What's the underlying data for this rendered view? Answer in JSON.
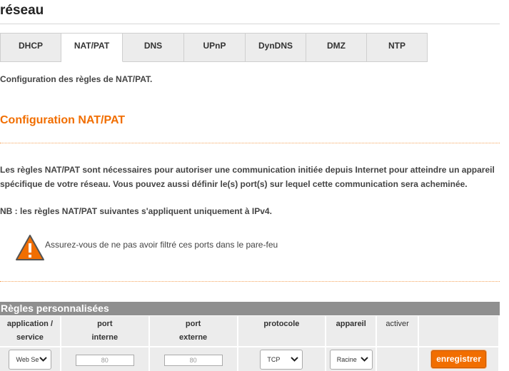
{
  "page": {
    "title": "réseau"
  },
  "tabs": [
    {
      "label": "DHCP"
    },
    {
      "label": "NAT/PAT"
    },
    {
      "label": "DNS"
    },
    {
      "label": "UPnP"
    },
    {
      "label": "DynDNS"
    },
    {
      "label": "DMZ"
    },
    {
      "label": "NTP"
    }
  ],
  "active_tab": "NAT/PAT",
  "intro": "Configuration des règles de NAT/PAT.",
  "section": {
    "title": "Configuration NAT/PAT",
    "paragraph": "Les règles NAT/PAT sont nécessaires pour autoriser une communication initiée depuis Internet pour atteindre un appareil spécifique de votre réseau. Vous pouvez aussi définir le(s) port(s) sur lequel cette communication sera acheminée.",
    "note": "NB : les règles NAT/PAT suivantes s'appliquent uniquement à IPv4.",
    "warning": "Assurez-vous de ne pas avoir filtré ces ports dans le pare-feu"
  },
  "rules": {
    "header": "Règles personnalisées",
    "columns": {
      "application_1": "application /",
      "application_2": "service",
      "port_int_1": "port",
      "port_int_2": "interne",
      "port_ext_1": "port",
      "port_ext_2": "externe",
      "protocol": "protocole",
      "device": "appareil",
      "activate": "activer"
    },
    "row": {
      "application": "Web Se",
      "port_internal_placeholder": "80",
      "port_external_placeholder": "80",
      "protocol": "TCP",
      "device": "Racine",
      "save_label": "enregistrer"
    }
  },
  "colors": {
    "accent": "#f16e00",
    "header_bg": "#8f8f8f",
    "cell_bg": "#ececec"
  }
}
